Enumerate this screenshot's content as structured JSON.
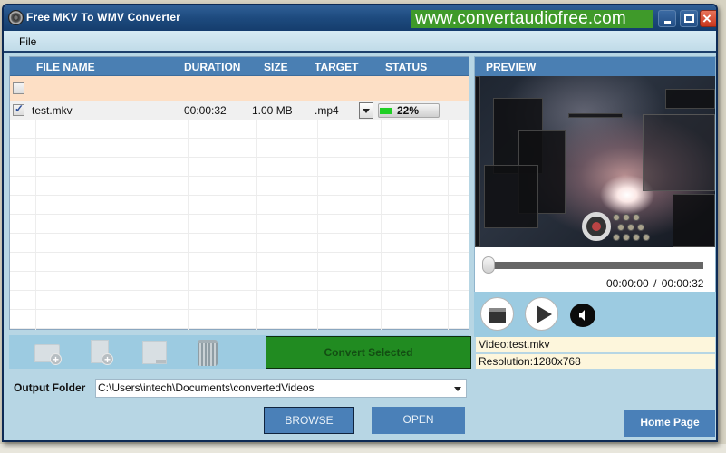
{
  "window": {
    "title": "Free MKV To WMV Converter",
    "site_link": "www.convertaudiofree.com",
    "controls": {
      "minimize": "minimize",
      "maximize": "maximize",
      "close": "×"
    }
  },
  "menu": {
    "items": [
      {
        "label": "File"
      }
    ]
  },
  "file_table": {
    "columns": [
      "FILE NAME",
      "DURATION",
      "SIZE",
      "TARGET",
      "STATUS"
    ],
    "select_all_checked": false,
    "rows": [
      {
        "checked": true,
        "file_name": "test.mkv",
        "duration": "00:00:32",
        "size": "1.00 MB",
        "target": ".mp4",
        "status_percent": 22,
        "status_label": "22%"
      }
    ]
  },
  "toolbar": {
    "icons": [
      "add-folder-icon",
      "add-file-icon",
      "remove-icon",
      "trash-icon"
    ],
    "convert_label": "Convert Selected",
    "convert_color": "#218b21"
  },
  "output": {
    "label": "Output Folder",
    "path": "C:\\Users\\intech\\Documents\\convertedVideos",
    "browse_label": "BROWSE",
    "open_label": "OPEN"
  },
  "preview": {
    "header": "PREVIEW",
    "position": "00:00:00",
    "separator": "/",
    "duration": "00:00:32",
    "progress_fraction": 0.0,
    "video_info": "Video:test.mkv",
    "resolution_info": "Resolution:1280x768"
  },
  "home_label": "Home Page",
  "colors": {
    "header_blue": "#4a7fb3",
    "panel_bg": "#b7d6e4",
    "toolbar_bg": "#9ccbe1",
    "select_row_bg": "#fddfc5",
    "progress_green": "#1fcf24",
    "info_bg": "#fdf6dc"
  }
}
